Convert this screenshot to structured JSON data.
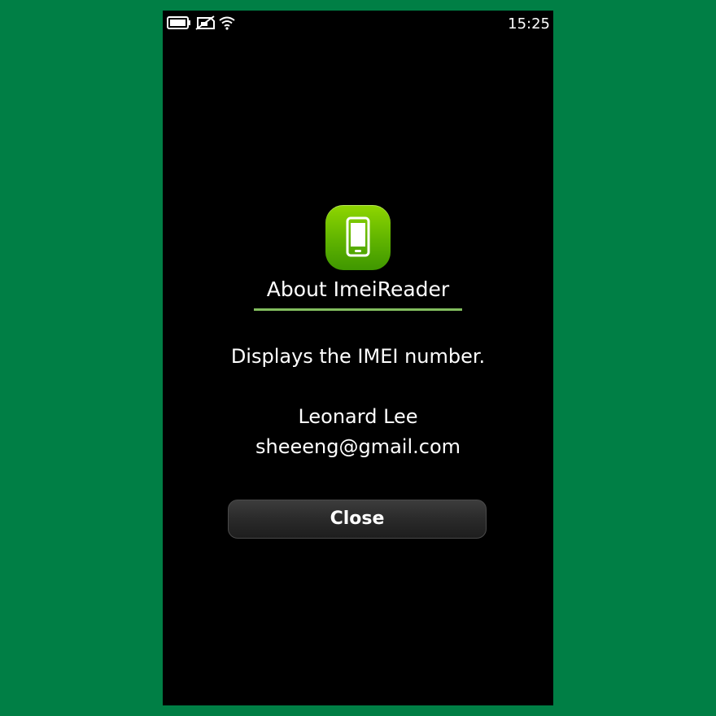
{
  "status_bar": {
    "time": "15:25",
    "icons": [
      "battery-icon",
      "no-sim-icon",
      "wifi-icon"
    ]
  },
  "dialog": {
    "title": "About ImeiReader",
    "description": "Displays the IMEI number.",
    "author_name": "Leonard Lee",
    "author_email": "sheeeng@gmail.com",
    "close_label": "Close",
    "app_icon": "phone-icon"
  },
  "colors": {
    "background": "#007f45",
    "screen": "#000000",
    "accent": "#82be5e",
    "icon_green": "#6cc000"
  }
}
